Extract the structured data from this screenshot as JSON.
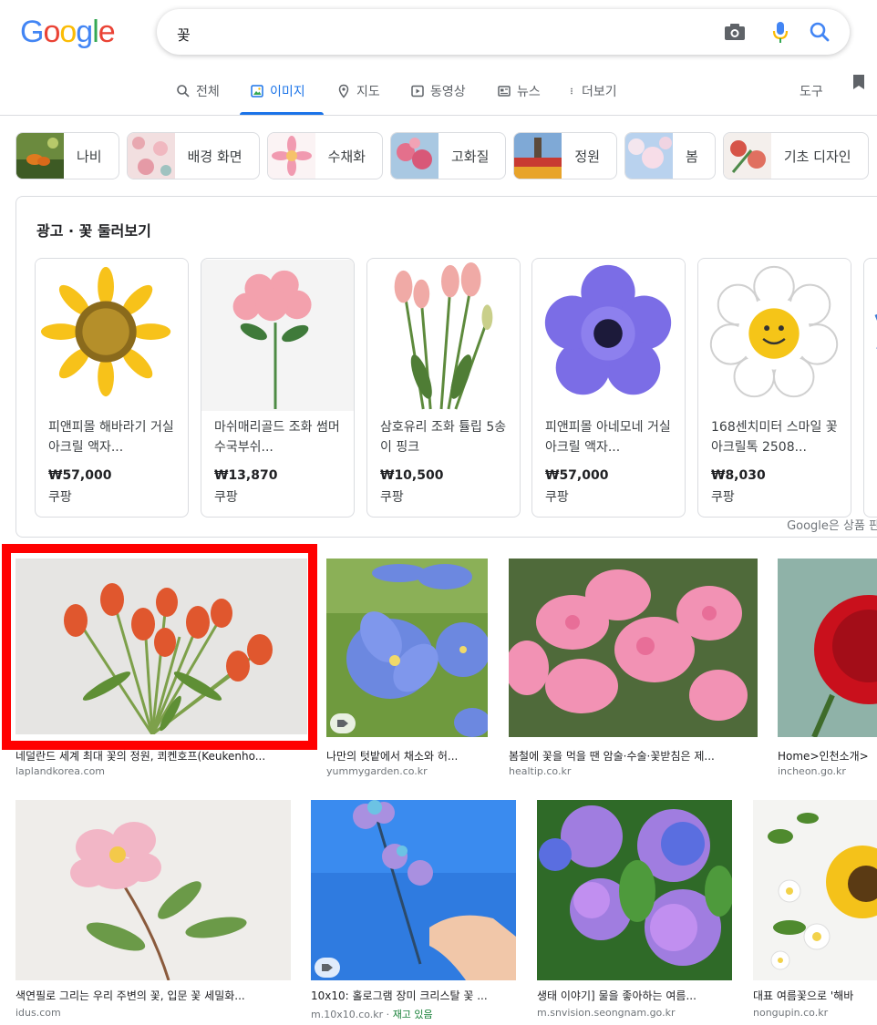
{
  "logo": "Google",
  "search": {
    "query": "꽃"
  },
  "tabs": [
    {
      "label": "전체",
      "icon": "search-icon"
    },
    {
      "label": "이미지",
      "icon": "image-icon",
      "active": true
    },
    {
      "label": "지도",
      "icon": "map-pin-icon"
    },
    {
      "label": "동영상",
      "icon": "play-icon"
    },
    {
      "label": "뉴스",
      "icon": "news-icon"
    },
    {
      "label": "더보기",
      "icon": "more-vert-icon"
    },
    {
      "label": "도구"
    }
  ],
  "chips": [
    {
      "label": "나비",
      "color": "#5a7a3a"
    },
    {
      "label": "배경 화면",
      "color": "#e8b4b8"
    },
    {
      "label": "수채화",
      "color": "#f4a6b8"
    },
    {
      "label": "고화질",
      "color": "#d77a8c"
    },
    {
      "label": "정원",
      "color": "#c0483a"
    },
    {
      "label": "봄",
      "color": "#c9d9ee"
    },
    {
      "label": "기초 디자인",
      "color": "#d46b5a"
    }
  ],
  "ads": {
    "title": "광고 · 꽃 둘러보기",
    "disclaimer": "Google은 상품 판디",
    "products": [
      {
        "name": "피앤피몰 해바라기 거실 아크릴 액자...",
        "price": "₩57,000",
        "store": "쿠팡",
        "icon": "sunflower"
      },
      {
        "name": "마쉬매리골드 조화 썸머 수국부쉬...",
        "price": "₩13,870",
        "store": "쿠팡",
        "icon": "hydrangea"
      },
      {
        "name": "삼호유리 조화 튤립 5송이 핑크",
        "price": "₩10,500",
        "store": "쿠팡",
        "icon": "tulips"
      },
      {
        "name": "피앤피몰 아네모네 거실 아크릴 액자...",
        "price": "₩57,000",
        "store": "쿠팡",
        "icon": "anemone"
      },
      {
        "name": "168센치미터 스마일 꽃 아크릴톡 2508...",
        "price": "₩8,030",
        "store": "쿠팡",
        "icon": "smile-flower"
      }
    ]
  },
  "results": [
    {
      "title": "네덜란드 세계 최대 꽃의 정원, 쾨켄호프(Keukenho...",
      "source": "laplandkorea.com"
    },
    {
      "title": "나만의 텃밭에서 채소와 허...",
      "source": "yummygarden.co.kr"
    },
    {
      "title": "봄철에 꽃을 먹을 땐 암술·수술·꽃받침은 제...",
      "source": "healtip.co.kr"
    },
    {
      "title": "Home>인천소개>",
      "source": "incheon.go.kr"
    },
    {
      "title": "색연필로 그리는 우리 주변의 꽃, 입문 꽃 세밀화...",
      "source": "idus.com"
    },
    {
      "title": "10x10: 홀로그램 장미 크리스탈 꽃 ...",
      "source": "m.10x10.co.kr",
      "stock": "재고 있음"
    },
    {
      "title": "생태 이야기] 물을 좋아하는 여름...",
      "source": "m.snvision.seongnam.go.kr"
    },
    {
      "title": "대표 여름꽃으로 '해바",
      "source": "nongupin.co.kr"
    }
  ]
}
